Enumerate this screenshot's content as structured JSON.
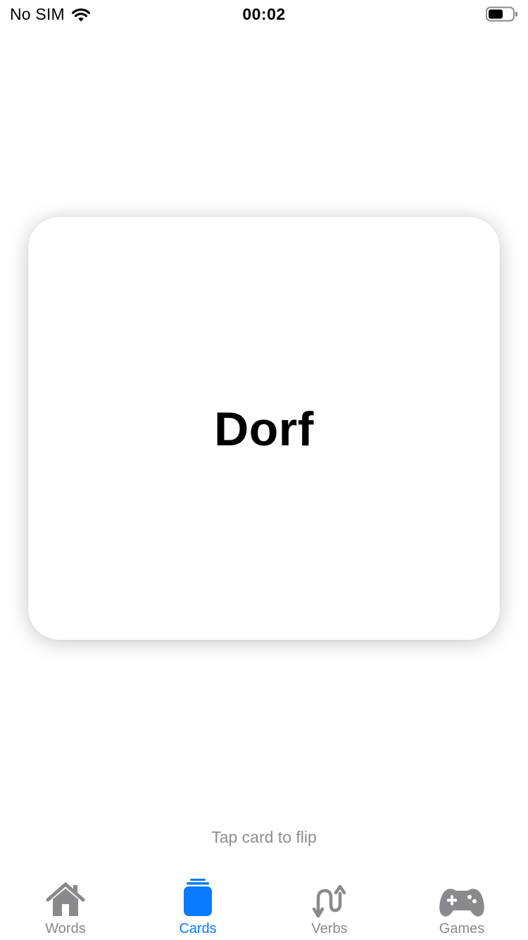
{
  "status_bar": {
    "carrier": "No SIM",
    "time": "00:02",
    "battery_level": 0.6
  },
  "card": {
    "word": "Dorf"
  },
  "hint": "Tap card to flip",
  "tabs": [
    {
      "label": "Words",
      "icon": "house-icon",
      "active": false
    },
    {
      "label": "Cards",
      "icon": "cards-stack-icon",
      "active": true
    },
    {
      "label": "Verbs",
      "icon": "arrows-updown-icon",
      "active": false
    },
    {
      "label": "Games",
      "icon": "gamecontroller-icon",
      "active": false
    }
  ],
  "colors": {
    "accent": "#0a7aff",
    "inactive": "#8a8a8e",
    "hint": "#8e8e93"
  }
}
